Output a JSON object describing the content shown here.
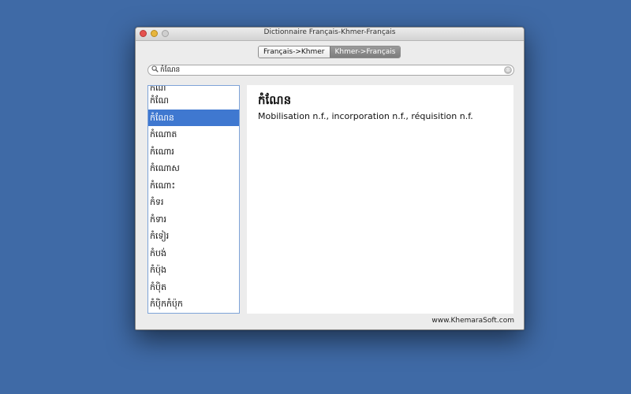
{
  "window": {
    "title": "Dictionnaire Français-Khmer-Français"
  },
  "tabs": [
    {
      "label": "Français->Khmer",
      "active": true
    },
    {
      "label": "Khmer->Français",
      "active": false
    }
  ],
  "search": {
    "value": "កំណែន",
    "icon": "magnifier",
    "clear_icon": "⊗"
  },
  "word_list": {
    "partial_top": "កំណ",
    "items": [
      "កំណែ",
      "កំណែន",
      "កំណោត",
      "កំណោរ",
      "កំណោស",
      "កំណោះ",
      "កំទរ",
      "កំទារ",
      "កំទៀរ",
      "កំបង់",
      "កំប៉ុង",
      "កំប៉ិត",
      "កំប៉ិកកំប៉ុក"
    ],
    "selected_index": 1
  },
  "entry": {
    "headword": "កំណែន",
    "definition": "Mobilisation n.f., incorporation n.f., réquisition n.f."
  },
  "footer": {
    "credit": "www.KhemaraSoft.com"
  },
  "colors": {
    "desktop": "#3f6aa6",
    "selection": "#3f78d0",
    "window": "#ececec"
  }
}
